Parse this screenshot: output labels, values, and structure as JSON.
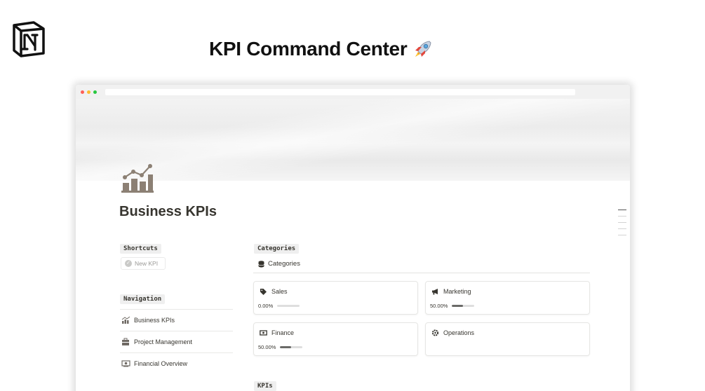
{
  "promo": {
    "title": "KPI Command Center"
  },
  "page": {
    "title": "Business KPIs"
  },
  "shortcuts": {
    "label": "Shortcuts",
    "new_button": "New KPI"
  },
  "navigation": {
    "label": "Navigation",
    "items": [
      {
        "label": "Business KPIs",
        "icon": "chart-icon"
      },
      {
        "label": "Project Management",
        "icon": "briefcase-icon"
      },
      {
        "label": "Financial Overview",
        "icon": "money-icon"
      }
    ]
  },
  "categories": {
    "label": "Categories",
    "view_title": "Categories",
    "cards": [
      {
        "name": "Sales",
        "icon": "tag-icon",
        "percent_text": "0.00%",
        "progress": 0.0
      },
      {
        "name": "Marketing",
        "icon": "megaphone-icon",
        "percent_text": "50.00%",
        "progress": 0.5
      },
      {
        "name": "Finance",
        "icon": "cash-icon",
        "percent_text": "50.00%",
        "progress": 0.5
      },
      {
        "name": "Operations",
        "icon": "gear-icon"
      }
    ]
  },
  "kpis": {
    "label": "KPIs"
  },
  "colors": {
    "traffic_red": "#ff5f57",
    "traffic_yellow": "#febc2e",
    "traffic_green": "#28c840",
    "progress_fill": "#6a6a68"
  }
}
